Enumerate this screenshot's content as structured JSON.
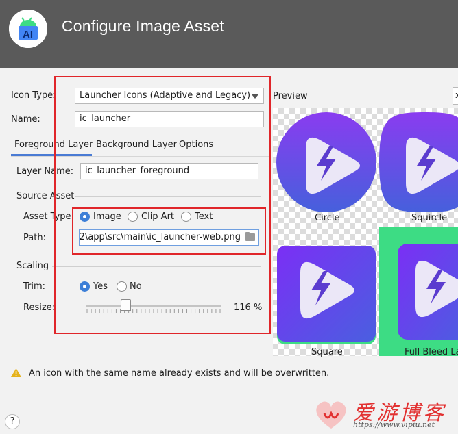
{
  "window": {
    "title": "Configure Image Asset"
  },
  "form": {
    "icon_type_label": "Icon Type:",
    "icon_type_value": "Launcher Icons (Adaptive and Legacy)",
    "name_label": "Name:",
    "name_value": "ic_launcher"
  },
  "tabs": [
    {
      "label": "Foreground Layer",
      "active": true
    },
    {
      "label": "Background Layer",
      "active": false
    },
    {
      "label": "Options",
      "active": false
    }
  ],
  "layer": {
    "layer_name_label": "Layer Name:",
    "layer_name_value": "ic_launcher_foreground",
    "source_asset_title": "Source Asset",
    "asset_type_label": "Asset Type:",
    "asset_types": [
      {
        "label": "Image",
        "checked": true
      },
      {
        "label": "Clip Art",
        "checked": false
      },
      {
        "label": "Text",
        "checked": false
      }
    ],
    "path_label": "Path:",
    "path_value": "2\\app\\src\\main\\ic_launcher-web.png"
  },
  "scaling": {
    "title": "Scaling",
    "trim_label": "Trim:",
    "trim_options": [
      {
        "label": "Yes",
        "checked": true
      },
      {
        "label": "No",
        "checked": false
      }
    ],
    "resize_label": "Resize:",
    "resize_value": "116 %",
    "resize_percent": 116
  },
  "preview": {
    "label": "Preview",
    "dropdown_text": "x",
    "shapes": [
      {
        "caption": "Circle"
      },
      {
        "caption": "Squircle"
      },
      {
        "caption": "Square"
      },
      {
        "caption": "Full Bleed Lay"
      }
    ]
  },
  "warning": {
    "text": "An icon with the same name already exists and will be overwritten."
  },
  "help": {
    "label": "?"
  },
  "watermark": {
    "text": "爱游博客",
    "url": "https://www.vipiu.net"
  },
  "colors": {
    "header_bg": "#5a5a5a",
    "accent": "#3d7fd7",
    "highlight_box": "#e0262a",
    "icon_gradient_top": "#7c4dff",
    "icon_gradient_bottom": "#4f5bd5",
    "full_bleed_bg": "#3ddc84"
  }
}
